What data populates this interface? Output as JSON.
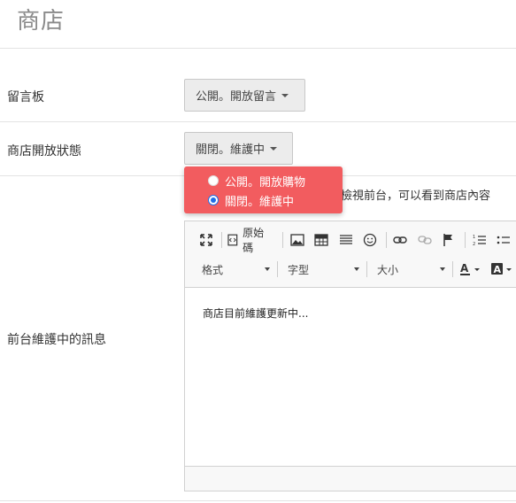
{
  "page": {
    "title": "商店"
  },
  "rows": {
    "board": {
      "label": "留言板",
      "value": "公開。開放留言"
    },
    "shop_status": {
      "label": "商店開放狀態",
      "value": "關閉。維護中",
      "options": [
        {
          "label": "公開。開放購物",
          "selected": false
        },
        {
          "label": "關閉。維護中",
          "selected": true
        }
      ],
      "hint": "在檢視前台，可以看到商店內容"
    },
    "maintenance": {
      "label": "前台維護中的訊息"
    }
  },
  "editor": {
    "source_label": "原始碼",
    "format_label": "格式",
    "font_label": "字型",
    "size_label": "大小",
    "content": "商店目前維護更新中..."
  },
  "colors": {
    "popup_bg": "#f25c5f",
    "radio_selected": "#1e6fe8"
  }
}
